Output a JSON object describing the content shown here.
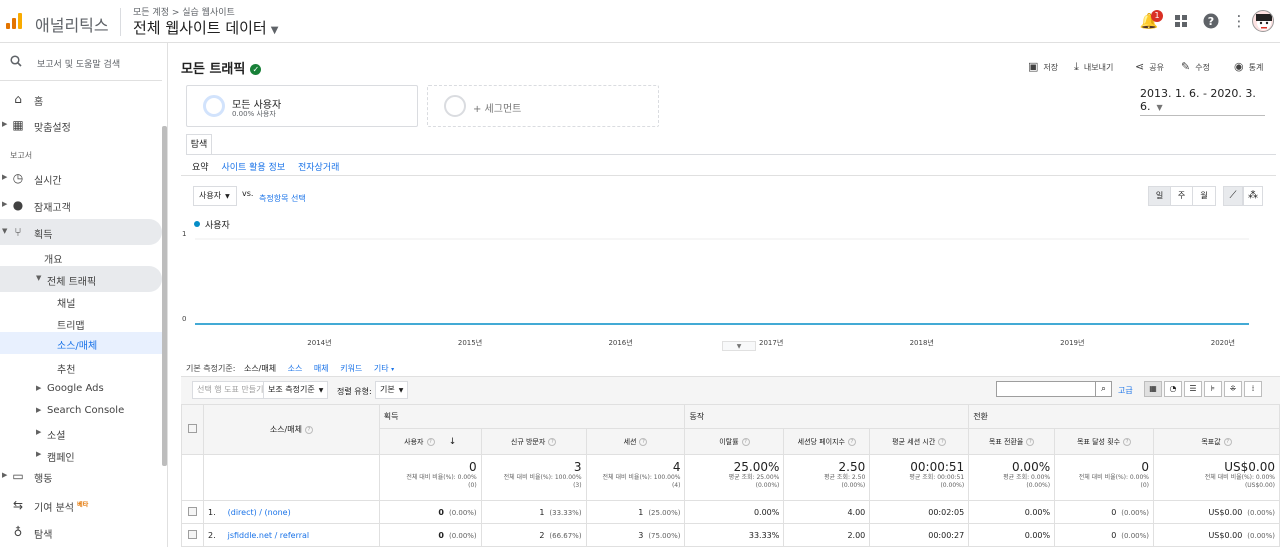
{
  "topbar": {
    "app_title": "애널리틱스",
    "breadcrumb": "모든 계정 > 실습 웹사이트",
    "property": "전체 웹사이트 데이터",
    "notification_count": "1"
  },
  "sidebar": {
    "search_label": "보고서 및 도움말 검색",
    "home": "홈",
    "customization": "맞춤설정",
    "reports_label": "보고서",
    "realtime": "실시간",
    "audience": "잠재고객",
    "acquisition": "획득",
    "overview": "개요",
    "all_traffic": "전체 트래픽",
    "channels": "채널",
    "treemaps": "트리맵",
    "source_medium": "소스/매체",
    "referrals": "추천",
    "google_ads": "Google Ads",
    "search_console": "Search Console",
    "social": "소셜",
    "campaigns": "캠페인",
    "behavior": "행동",
    "attribution": "기여 분석",
    "attribution_beta": "베타",
    "discover": "탐색"
  },
  "header": {
    "title": "모든 트래픽",
    "save": "저장",
    "export": "내보내기",
    "share": "공유",
    "edit": "수정",
    "insights": "통계"
  },
  "segments": {
    "active_name": "모든 사용자",
    "active_sub": "0.00% 사용자",
    "add_label": "+ 세그먼트"
  },
  "date_range": "2013. 1. 6. - 2020. 3. 6.",
  "tabs": {
    "explore": "탐색",
    "summary": "요약",
    "site_usage": "사이트 활용 정보",
    "ecommerce": "전자상거래"
  },
  "chart_controls": {
    "metric": "사용자",
    "vs": "vs.",
    "select_metric": "측정항목 선택",
    "day": "일",
    "week": "주",
    "month": "월"
  },
  "chart_data": {
    "type": "line",
    "series": [
      {
        "name": "사용자",
        "values": [
          0,
          0,
          0,
          0,
          0,
          0,
          0,
          0
        ]
      }
    ],
    "x": [
      "2013",
      "2014",
      "2015",
      "2016",
      "2017",
      "2018",
      "2019",
      "2020"
    ],
    "x_tick_labels": [
      "2014년",
      "2015년",
      "2016년",
      "2017년",
      "2018년",
      "2019년",
      "2020년"
    ],
    "y_tick_labels": [
      "1",
      "0"
    ],
    "ylim": [
      0,
      1
    ],
    "color": "#058dc7"
  },
  "dimensions": {
    "label": "기본 측정기준:",
    "current": "소스/매체",
    "source": "소스",
    "medium": "매체",
    "keyword": "키워드",
    "other": "기타"
  },
  "toolbar": {
    "create_segment": "선택 행 도표 만들기",
    "secondary_dim": "보조 측정기준",
    "sort_label": "정렬 유형:",
    "sort_value": "기본",
    "advanced": "고급"
  },
  "table": {
    "col_source": "소스/매체",
    "group_acq": "획득",
    "group_behavior": "동작",
    "group_conv": "전환",
    "columns": [
      "사용자",
      "신규 방문자",
      "세션",
      "이탈률",
      "세션당 페이지수",
      "평균 세션 시간",
      "목표 전환율",
      "목표 달성 횟수",
      "목표값"
    ],
    "totals": [
      {
        "v": "0",
        "s1": "전체 대비 비율(%): 0.00%",
        "s2": "(0)"
      },
      {
        "v": "3",
        "s1": "전체 대비 비율(%): 100.00%",
        "s2": "(3)"
      },
      {
        "v": "4",
        "s1": "전체 대비 비율(%): 100.00%",
        "s2": "(4)"
      },
      {
        "v": "25.00%",
        "s1": "평균 조회: 25.00%",
        "s2": "(0.00%)"
      },
      {
        "v": "2.50",
        "s1": "평균 조회: 2.50",
        "s2": "(0.00%)"
      },
      {
        "v": "00:00:51",
        "s1": "평균 조회: 00:00:51",
        "s2": "(0.00%)"
      },
      {
        "v": "0.00%",
        "s1": "평균 조회: 0.00%",
        "s2": "(0.00%)"
      },
      {
        "v": "0",
        "s1": "전체 대비 비율(%): 0.00%",
        "s2": "(0)"
      },
      {
        "v": "US$0.00",
        "s1": "전체 대비 비율(%): 0.00%",
        "s2": "(US$0.00)"
      }
    ],
    "rows": [
      {
        "idx": "1.",
        "src": "(direct) / (none)",
        "users": "0",
        "users_p": "(0.00%)",
        "new": "1",
        "new_p": "(33.33%)",
        "sess": "1",
        "sess_p": "(25.00%)",
        "bounce": "0.00%",
        "pps": "4.00",
        "dur": "00:02:05",
        "conv": "0.00%",
        "goals": "0",
        "goals_p": "(0.00%)",
        "val": "US$0.00",
        "val_p": "(0.00%)"
      },
      {
        "idx": "2.",
        "src": "jsfiddle.net / referral",
        "users": "0",
        "users_p": "(0.00%)",
        "new": "2",
        "new_p": "(66.67%)",
        "sess": "3",
        "sess_p": "(75.00%)",
        "bounce": "33.33%",
        "pps": "2.00",
        "dur": "00:00:27",
        "conv": "0.00%",
        "goals": "0",
        "goals_p": "(0.00%)",
        "val": "US$0.00",
        "val_p": "(0.00%)"
      }
    ]
  }
}
